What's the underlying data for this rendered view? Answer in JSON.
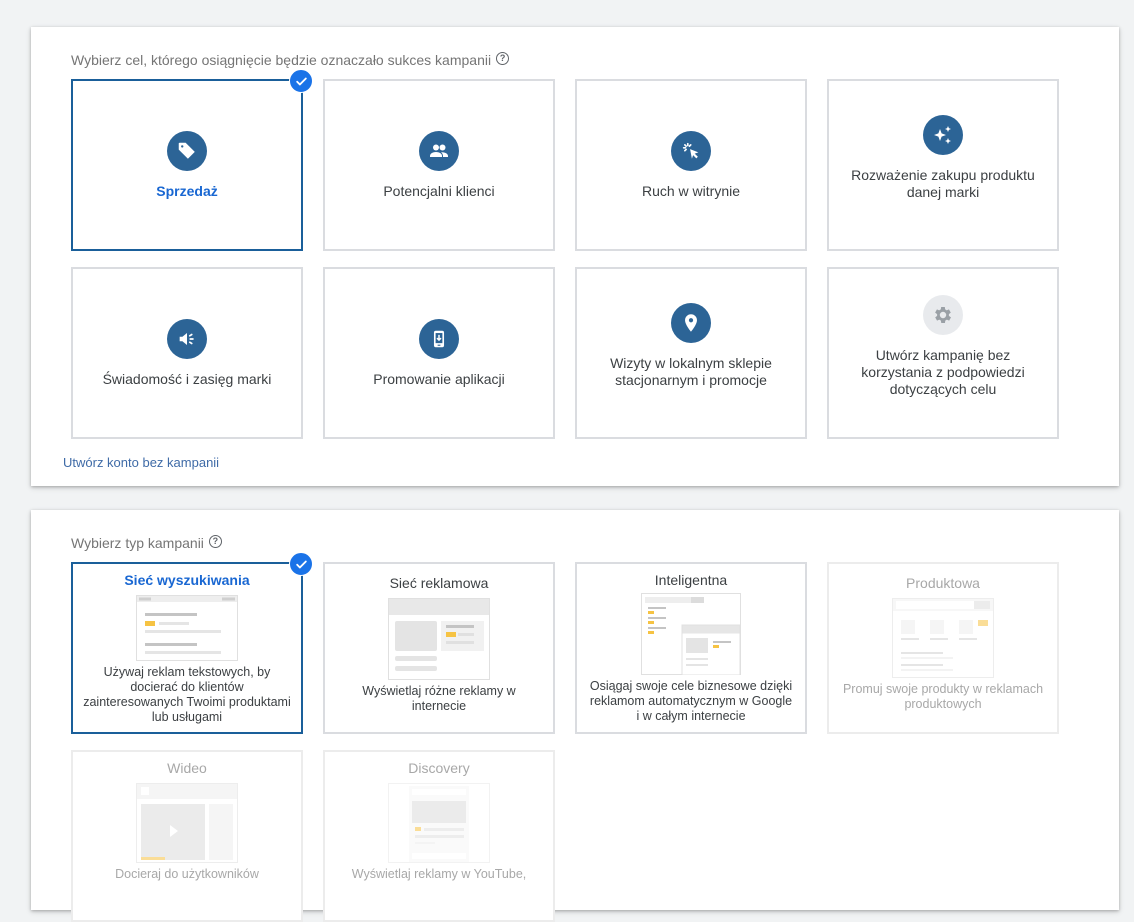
{
  "colors": {
    "accent": "#1a73e8",
    "selected_border": "#1a5f9a",
    "icon_bg": "#2c6496",
    "link": "#3f6ba7",
    "ad_highlight": "#f6c343"
  },
  "goals": {
    "title": "Wybierz cel, którego osiągnięcie będzie oznaczało sukces kampanii",
    "help_icon": "?",
    "items": [
      {
        "label": "Sprzedaż",
        "icon": "tag-icon",
        "selected": true
      },
      {
        "label": "Potencjalni klienci",
        "icon": "people-icon",
        "selected": false
      },
      {
        "label": "Ruch w witrynie",
        "icon": "cursor-click-icon",
        "selected": false
      },
      {
        "label": "Rozważenie zakupu produktu danej marki",
        "icon": "sparkle-icon",
        "selected": false
      },
      {
        "label": "Świadomość i zasięg marki",
        "icon": "megaphone-icon",
        "selected": false
      },
      {
        "label": "Promowanie aplikacji",
        "icon": "phone-download-icon",
        "selected": false
      },
      {
        "label": "Wizyty w lokalnym sklepie stacjonarnym i promocje",
        "icon": "location-pin-icon",
        "selected": false
      },
      {
        "label": "Utwórz kampanię bez korzystania z podpowiedzi dotyczących celu",
        "icon": "gear-icon",
        "selected": false
      }
    ],
    "no_campaign_link": "Utwórz konto bez kampanii"
  },
  "campaign_types": {
    "title": "Wybierz typ kampanii",
    "help_icon": "?",
    "items": [
      {
        "title": "Sieć wyszukiwania",
        "description": "Używaj reklam tekstowych, by docierać do klientów zainteresowanych Twoimi produktami lub usługami",
        "selected": true,
        "enabled": true
      },
      {
        "title": "Sieć reklamowa",
        "description": "Wyświetlaj różne reklamy w internecie",
        "selected": false,
        "enabled": true
      },
      {
        "title": "Inteligentna",
        "description": "Osiągaj swoje cele biznesowe dzięki reklamom automatycznym w Google i w całym internecie",
        "selected": false,
        "enabled": true
      },
      {
        "title": "Produktowa",
        "description": "Promuj swoje produkty w reklamach produktowych",
        "selected": false,
        "enabled": false
      },
      {
        "title": "Wideo",
        "description": "Docieraj do użytkowników",
        "selected": false,
        "enabled": false
      },
      {
        "title": "Discovery",
        "description": "Wyświetlaj reklamy w YouTube,",
        "selected": false,
        "enabled": false
      }
    ]
  }
}
